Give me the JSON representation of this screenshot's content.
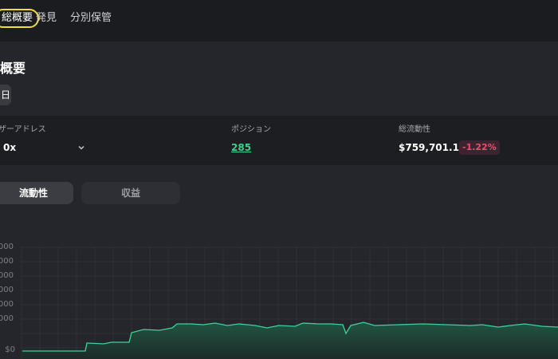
{
  "nav": {
    "tabs": [
      {
        "label": "総概要",
        "active": true
      },
      {
        "label": "発見",
        "active": false
      },
      {
        "label": "分別保管",
        "active": false
      }
    ]
  },
  "overview": {
    "title": "概要",
    "period_label": "日"
  },
  "stats": {
    "user_address_label": "ザーアドレス",
    "user_address_value": "0x",
    "positions_label": "ポジション",
    "positions_value": "285",
    "total_liquidity_label": "総流動性",
    "total_liquidity_value": "$759,701.13",
    "liquidity_change": "-1.22%"
  },
  "toggles": {
    "liquidity": "流動性",
    "revenue": "収益"
  },
  "chart_data": {
    "type": "area",
    "ylabels": [
      "000",
      "000",
      "000",
      "000",
      "000",
      "000",
      "$0"
    ],
    "ymax_fraction_line": 0.0,
    "series": [
      {
        "values": [
          2,
          2,
          2,
          2,
          2,
          2,
          2,
          2,
          2,
          2,
          2,
          2,
          2,
          2,
          2,
          2,
          2,
          2,
          2,
          2,
          2,
          2,
          2,
          2,
          2,
          2,
          2,
          2,
          2,
          2,
          2,
          2,
          2,
          2,
          2,
          2,
          2,
          2,
          2,
          2,
          2,
          2,
          2,
          2,
          2,
          2,
          2,
          2,
          2,
          2,
          2,
          2,
          2,
          2,
          2,
          2,
          2,
          2,
          2,
          2,
          2,
          2,
          2,
          2,
          2,
          2,
          2,
          2,
          2,
          2,
          2,
          2,
          2,
          2,
          2,
          2,
          2,
          2,
          2,
          2,
          2,
          2,
          2,
          2,
          2,
          2,
          2,
          2,
          2,
          2,
          2,
          2,
          2,
          2,
          2,
          2,
          2,
          2,
          2,
          2,
          2,
          2,
          2,
          2,
          2,
          2,
          2,
          2,
          2,
          2,
          2,
          2,
          2,
          2,
          2,
          2,
          2,
          2,
          2,
          2,
          2,
          2,
          2,
          2,
          2,
          2,
          2,
          2,
          2,
          2,
          2,
          2,
          2,
          2,
          2,
          2,
          2,
          2,
          2,
          2,
          2,
          2,
          2,
          2,
          2,
          2,
          2,
          2,
          2,
          2,
          2,
          2,
          2,
          2,
          2,
          2,
          2,
          2,
          2,
          2,
          2,
          2,
          2,
          2,
          2,
          2,
          2,
          2,
          2,
          2,
          2,
          2,
          2,
          2,
          2,
          2,
          2,
          2,
          2,
          2,
          2,
          2,
          2,
          2,
          2,
          2,
          2,
          2,
          2,
          2,
          2,
          2,
          2,
          2,
          2,
          2,
          2,
          2,
          2,
          2,
          2,
          2,
          2,
          2
        ]
      }
    ],
    "colors": {
      "line": "#3ad39a",
      "fill_top": "#1f5a45",
      "fill_bottom": "#1d2b28",
      "grid": "#34353a"
    }
  }
}
